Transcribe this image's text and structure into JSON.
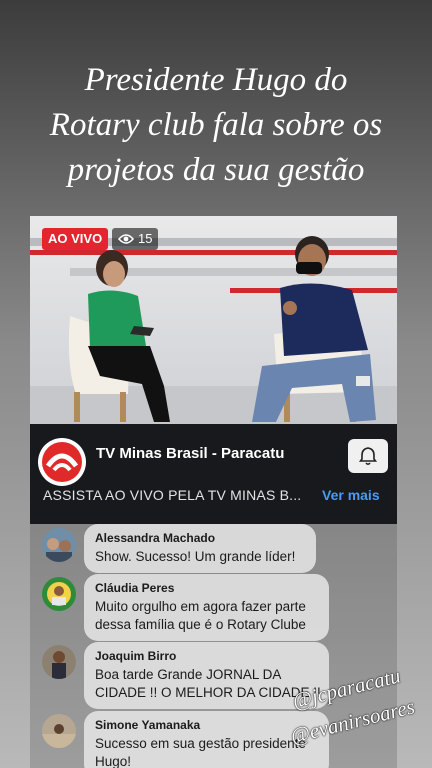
{
  "headline": {
    "line1": "Presidente Hugo do",
    "line2": "Rotary club fala sobre os",
    "line3": "projetos da sua gestão"
  },
  "video": {
    "live_label": "AO VIVO",
    "viewer_count": "15"
  },
  "channel": {
    "name": "TV Minas Brasil - Paracatu",
    "description": "ASSISTA AO VIVO PELA TV MINAS B...",
    "see_more": "Ver mais"
  },
  "comments": [
    {
      "name": "Alessandra Machado",
      "lines": [
        "Show. Sucesso! Um grande líder!"
      ]
    },
    {
      "name": "Cláudia Peres",
      "lines": [
        "Muito orgulho em agora fazer parte",
        "dessa família que é o Rotary Clube"
      ]
    },
    {
      "name": "Joaquim Birro",
      "lines": [
        "Boa tarde Grande  JORNAL DA",
        "CIDADE !! O MELHOR DA CIDADE !!"
      ]
    },
    {
      "name": "Simone Yamanaka",
      "lines": [
        "Sucesso em sua gestão presidente",
        "Hugo!"
      ]
    }
  ],
  "watermark": {
    "line1": "@jcparacatu",
    "line2": "@evanirsoares"
  },
  "colors": {
    "live_red": "#e4252f",
    "link_blue": "#4b9bf5",
    "channel_bar": "#17191c"
  }
}
